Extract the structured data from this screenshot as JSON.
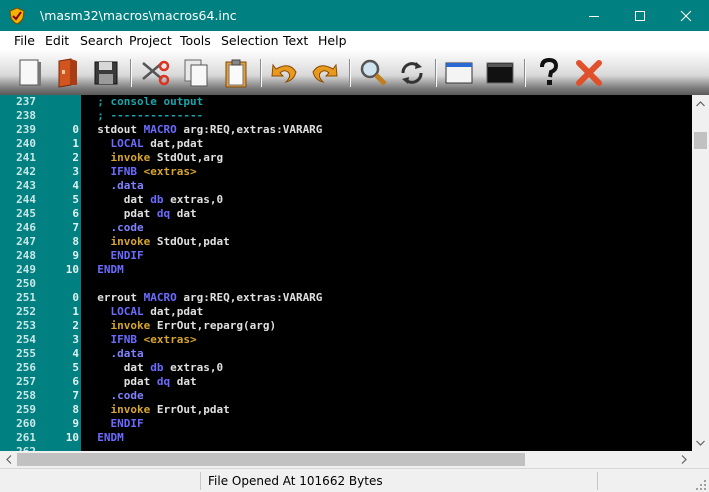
{
  "window": {
    "title": "\\masm32\\macros\\macros64.inc"
  },
  "menu": {
    "items": [
      "File",
      "Edit",
      "Search",
      "Project",
      "Tools",
      "Selection",
      "Text",
      "Help"
    ]
  },
  "toolbar": {
    "icons": [
      "new-file-icon",
      "open-file-icon",
      "save-icon",
      "cut-icon",
      "copy-icon",
      "paste-icon",
      "undo-icon",
      "redo-icon",
      "find-icon",
      "replace-icon",
      "window-icon",
      "console-icon",
      "help-icon",
      "close-icon"
    ]
  },
  "editor": {
    "lines": [
      {
        "num": "237",
        "count": "",
        "code": "  ; console output"
      },
      {
        "num": "238",
        "count": "",
        "code": "  ; --------------"
      },
      {
        "num": "239",
        "count": "0",
        "code": "  stdout MACRO arg:REQ,extras:VARARG"
      },
      {
        "num": "240",
        "count": "1",
        "code": "    LOCAL dat,pdat"
      },
      {
        "num": "241",
        "count": "2",
        "code": "    invoke StdOut,arg"
      },
      {
        "num": "242",
        "count": "3",
        "code": "    IFNB <extras>"
      },
      {
        "num": "243",
        "count": "4",
        "code": "    .data"
      },
      {
        "num": "244",
        "count": "5",
        "code": "      dat db extras,0"
      },
      {
        "num": "245",
        "count": "6",
        "code": "      pdat dq dat"
      },
      {
        "num": "246",
        "count": "7",
        "code": "    .code"
      },
      {
        "num": "247",
        "count": "8",
        "code": "    invoke StdOut,pdat"
      },
      {
        "num": "248",
        "count": "9",
        "code": "    ENDIF"
      },
      {
        "num": "249",
        "count": "10",
        "code": "  ENDM"
      },
      {
        "num": "250",
        "count": "",
        "code": ""
      },
      {
        "num": "251",
        "count": "0",
        "code": "  errout MACRO arg:REQ,extras:VARARG"
      },
      {
        "num": "252",
        "count": "1",
        "code": "    LOCAL dat,pdat"
      },
      {
        "num": "253",
        "count": "2",
        "code": "    invoke ErrOut,reparg(arg)"
      },
      {
        "num": "254",
        "count": "3",
        "code": "    IFNB <extras>"
      },
      {
        "num": "255",
        "count": "4",
        "code": "    .data"
      },
      {
        "num": "256",
        "count": "5",
        "code": "      dat db extras,0"
      },
      {
        "num": "257",
        "count": "6",
        "code": "      pdat dq dat"
      },
      {
        "num": "258",
        "count": "7",
        "code": "    .code"
      },
      {
        "num": "259",
        "count": "8",
        "code": "    invoke ErrOut,pdat"
      },
      {
        "num": "260",
        "count": "9",
        "code": "    ENDIF"
      },
      {
        "num": "261",
        "count": "10",
        "code": "  ENDM"
      },
      {
        "num": "262",
        "count": "",
        "code": ""
      }
    ]
  },
  "status": {
    "text": "File Opened At 101662 Bytes"
  },
  "colors": {
    "titlebar": "#008080",
    "gutter": "#008080",
    "editor_bg": "#000000",
    "comment": "#18a4ac",
    "directive": "#6b6bff",
    "keyword": "#d6a52c"
  }
}
